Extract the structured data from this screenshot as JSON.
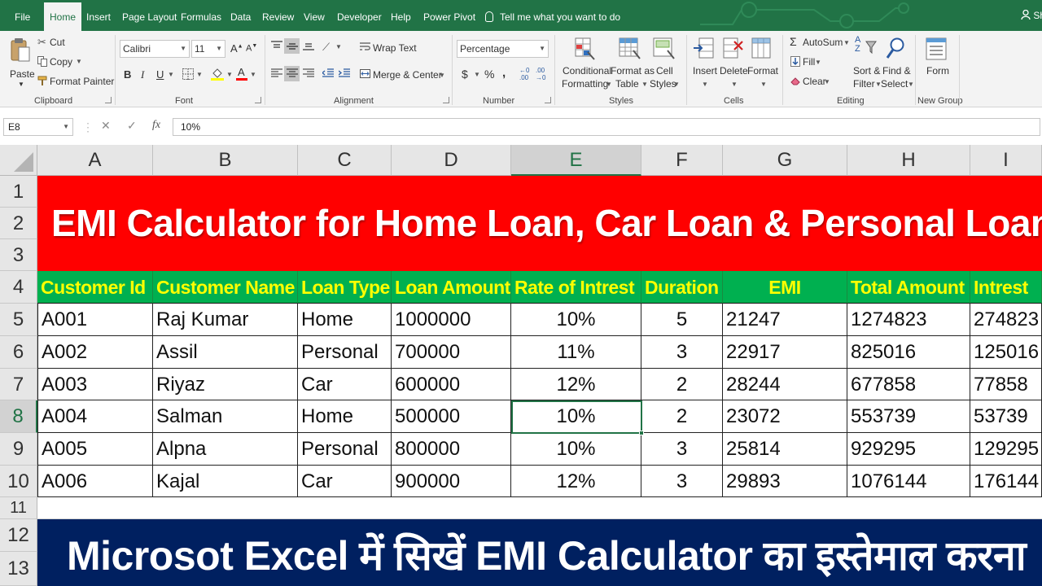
{
  "tabs": [
    "File",
    "Home",
    "Insert",
    "Page Layout",
    "Formulas",
    "Data",
    "Review",
    "View",
    "Developer",
    "Help",
    "Power Pivot"
  ],
  "active_tab": "Home",
  "tell_me": "Tell me what you want to do",
  "user_initials": "Sh",
  "ribbon": {
    "clipboard": {
      "paste": "Paste",
      "cut": "Cut",
      "copy": "Copy",
      "format_painter": "Format Painter",
      "label": "Clipboard"
    },
    "font": {
      "name": "Calibri",
      "size": "11",
      "bold": "B",
      "italic": "I",
      "underline": "U",
      "label": "Font"
    },
    "alignment": {
      "wrap_text": "Wrap Text",
      "merge_center": "Merge & Center",
      "label": "Alignment"
    },
    "number": {
      "format": "Percentage",
      "currency": "$",
      "percent": "%",
      "comma": ",",
      "label": "Number"
    },
    "styles": {
      "conditional_1": "Conditional",
      "conditional_2": "Formatting",
      "format_as_1": "Format as",
      "format_as_2": "Table",
      "cell_1": "Cell",
      "cell_2": "Styles",
      "label": "Styles"
    },
    "cells": {
      "insert": "Insert",
      "delete": "Delete",
      "format": "Format",
      "label": "Cells"
    },
    "editing": {
      "autosum": "AutoSum",
      "fill": "Fill",
      "clear": "Clear",
      "sort_1": "Sort &",
      "sort_2": "Filter",
      "find_1": "Find &",
      "find_2": "Select",
      "label": "Editing"
    },
    "new_group": {
      "form": "Form",
      "label": "New Group"
    }
  },
  "formula_bar": {
    "name_box": "E8",
    "cancel": "✕",
    "enter": "✓",
    "fx": "fx",
    "value": "10%"
  },
  "columns": [
    "A",
    "B",
    "C",
    "D",
    "E",
    "F",
    "G",
    "H",
    "I"
  ],
  "selected_column": "E",
  "rows": [
    "1",
    "2",
    "3",
    "4",
    "5",
    "6",
    "7",
    "8",
    "9",
    "10",
    "11",
    "12",
    "13"
  ],
  "selected_row": "8",
  "sheet": {
    "title": "EMI Calculator for Home Loan, Car Loan & Personal Loan",
    "headers": [
      "Customer Id",
      "Customer Name",
      "Loan Type",
      "Loan Amount",
      "Rate of Intrest",
      "Duration",
      "EMI",
      "Total Amount",
      "Intrest"
    ],
    "data": [
      [
        "A001",
        "Raj Kumar",
        "Home",
        "1000000",
        "10%",
        "5",
        "21247",
        "1274823",
        "274823"
      ],
      [
        "A002",
        "Assil",
        "Personal",
        "700000",
        "11%",
        "3",
        "22917",
        "825016",
        "125016"
      ],
      [
        "A003",
        "Riyaz",
        "Car",
        "600000",
        "12%",
        "2",
        "28244",
        "677858",
        "77858"
      ],
      [
        "A004",
        "Salman",
        "Home",
        "500000",
        "10%",
        "2",
        "23072",
        "553739",
        "53739"
      ],
      [
        "A005",
        "Alpna",
        "Personal",
        "800000",
        "10%",
        "3",
        "25814",
        "929295",
        "129295"
      ],
      [
        "A006",
        "Kajal",
        "Car",
        "900000",
        "12%",
        "3",
        "29893",
        "1076144",
        "176144"
      ]
    ],
    "footer": "Microsot Excel में सिखें EMI Calculator का इस्तेमाल करना"
  },
  "colors": {
    "excel_green": "#217346",
    "title_red": "#ff0000",
    "header_green": "#00b050",
    "header_text": "#ffff00",
    "footer_navy": "#002060"
  }
}
